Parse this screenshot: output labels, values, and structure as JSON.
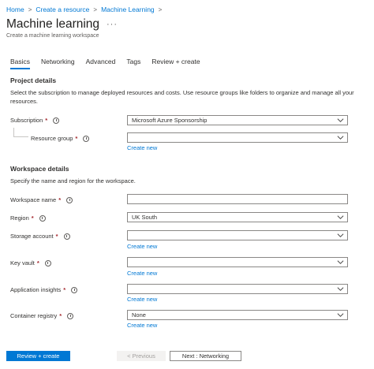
{
  "breadcrumb": {
    "items": [
      "Home",
      "Create a resource",
      "Machine Learning"
    ]
  },
  "page": {
    "title": "Machine learning",
    "more": "···",
    "subtitle": "Create a machine learning workspace"
  },
  "tabs": [
    {
      "label": "Basics",
      "active": true
    },
    {
      "label": "Networking"
    },
    {
      "label": "Advanced"
    },
    {
      "label": "Tags"
    },
    {
      "label": "Review + create"
    }
  ],
  "project": {
    "title": "Project details",
    "description": "Select the subscription to manage deployed resources and costs. Use resource groups like folders to organize and manage all your resources.",
    "subscription": {
      "label": "Subscription",
      "required": "*",
      "value": "Microsoft Azure Sponsorship"
    },
    "resource_group": {
      "label": "Resource group",
      "required": "*",
      "value": "",
      "link": "Create new"
    }
  },
  "workspace": {
    "title": "Workspace details",
    "description": "Specify the name and region for the workspace.",
    "name": {
      "label": "Workspace name",
      "required": "*",
      "value": ""
    },
    "region": {
      "label": "Region",
      "required": "*",
      "value": "UK South"
    },
    "storage": {
      "label": "Storage account",
      "required": "*",
      "value": "",
      "link": "Create new"
    },
    "keyvault": {
      "label": "Key vault",
      "required": "*",
      "value": "",
      "link": "Create new"
    },
    "insights": {
      "label": "Application insights",
      "required": "*",
      "value": "",
      "link": "Create new"
    },
    "registry": {
      "label": "Container registry",
      "required": "*",
      "value": "None",
      "link": "Create new"
    }
  },
  "footer": {
    "review": "Review + create",
    "previous": "< Previous",
    "next": "Next : Networking"
  },
  "colors": {
    "accent": "#0078d4",
    "required": "#a4262c",
    "border": "#8a8886"
  }
}
